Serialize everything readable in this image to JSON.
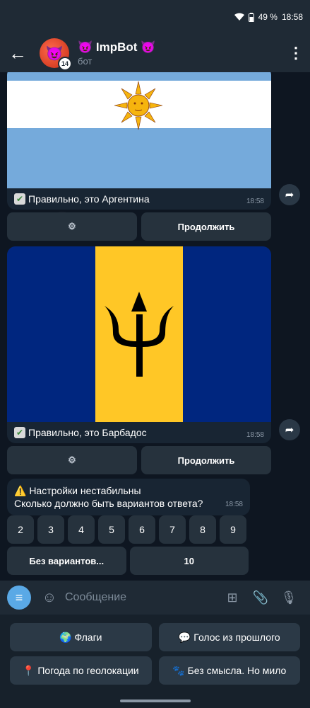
{
  "status": {
    "battery": "49 %",
    "time": "18:58"
  },
  "header": {
    "back_icon": "arrow-left-icon",
    "avatar_emoji": "😈",
    "avatar_badge": "14",
    "title": "😈 ImpBot 😈",
    "subtitle": "бот",
    "menu_icon": "more-vertical-icon"
  },
  "messages": [
    {
      "caption": "Правильно, это Аргентина",
      "time": "18:58",
      "flag": "argentina",
      "buttons": [
        "⚙",
        "Продолжить"
      ]
    },
    {
      "caption": "Правильно, это Барбадос",
      "time": "18:58",
      "flag": "barbados",
      "buttons": [
        "⚙",
        "Продолжить"
      ]
    }
  ],
  "settings_msg": {
    "line1": "⚠️ Настройки нестабильны",
    "line2": "Сколько должно быть вариантов ответа?",
    "time": "18:58",
    "numbers": [
      "2",
      "3",
      "4",
      "5",
      "6",
      "7",
      "8",
      "9"
    ],
    "options": [
      "Без вариантов...",
      "10"
    ]
  },
  "input": {
    "placeholder": "Сообщение"
  },
  "keyboard": {
    "rows": [
      [
        {
          "emoji": "🌍",
          "label": "Флаги"
        },
        {
          "emoji": "💬",
          "label": "Голос из прошлого"
        }
      ],
      [
        {
          "emoji": "📍",
          "label": "Погода по геолокации"
        },
        {
          "emoji": "🐾",
          "label": "Без смысла. Но мило"
        }
      ]
    ]
  },
  "colors": {
    "accent": "#5aa9e6",
    "bubble": "#182533",
    "background": "#0e1621"
  }
}
